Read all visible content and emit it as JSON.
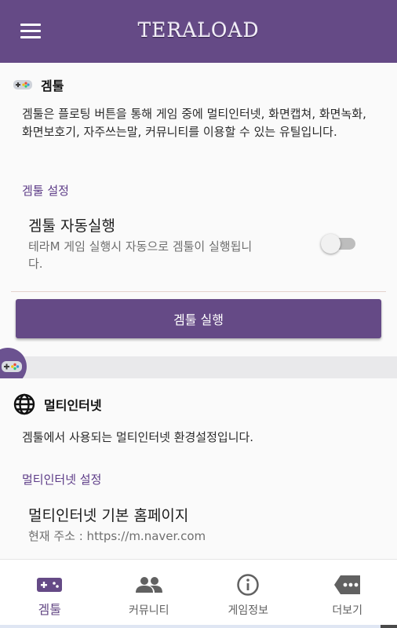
{
  "app_bar": {
    "title": "TERALOAD",
    "menu_icon": "hamburger-menu-icon"
  },
  "gametool": {
    "icon": "gamepad-icon",
    "title": "겜툴",
    "description": "겜툴은 플로팅 버튼을 통해 게임 중에 멀티인터넷, 화면캡쳐, 화면녹화, 화면보호기, 자주쓰는말, 커뮤니티를 이용할 수 있는 유틸입니다.",
    "settings_header": "겜툴 설정",
    "auto_run": {
      "title": "겜툴 자동실행",
      "summary": "테라M 게임 실행시 자동으로 겜툴이 실행됩니다.",
      "enabled": false
    },
    "run_button": "겜툴 실행"
  },
  "multi_internet": {
    "icon": "globe-icon",
    "title": "멀티인터넷",
    "description": "겜툴에서 사용되는 멀티인터넷 환경설정입니다.",
    "settings_header": "멀티인터넷 설정",
    "home_page": {
      "title": "멀티인터넷 기본 홈페이지",
      "summary": "현재 주소 : https://m.naver.com"
    }
  },
  "floating_button": {
    "icon": "gamepad-icon"
  },
  "bottom_nav": {
    "items": [
      {
        "label": "겜툴",
        "icon": "gamepad-icon",
        "active": true
      },
      {
        "label": "커뮤니티",
        "icon": "people-icon",
        "active": false
      },
      {
        "label": "게임정보",
        "icon": "info-icon",
        "active": false
      },
      {
        "label": "더보기",
        "icon": "more-tag-icon",
        "active": false
      }
    ]
  },
  "colors": {
    "primary": "#654a86",
    "accent_text": "#5c3b87",
    "nav_inactive": "#616161",
    "switch_track_off": "#bdbdbd"
  }
}
